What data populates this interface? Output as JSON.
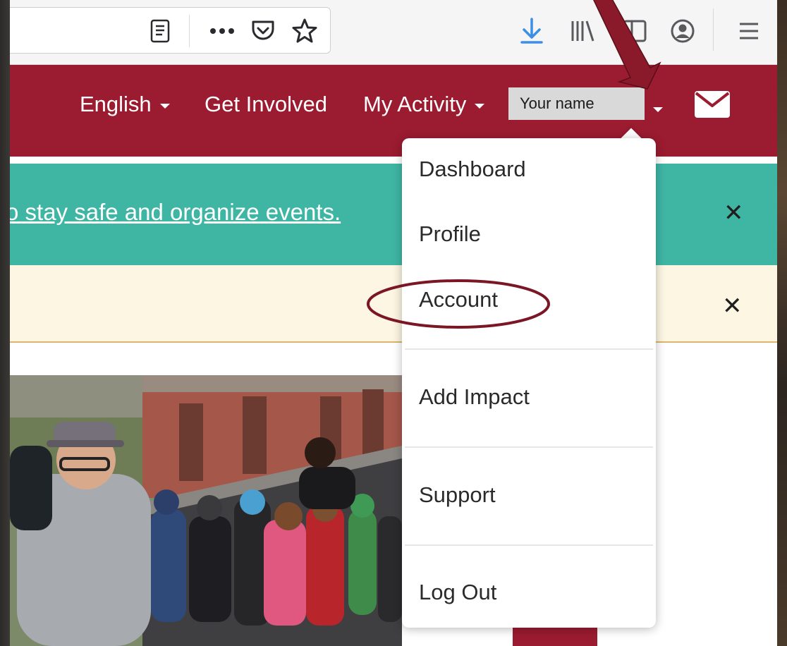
{
  "header": {
    "nav": {
      "language": "English",
      "get_involved": "Get Involved",
      "my_activity": "My Activity"
    },
    "user_name": "Your name"
  },
  "teal_banner": {
    "text": "o stay safe and organize events."
  },
  "user_menu": {
    "items": [
      "Dashboard",
      "Profile",
      "Account",
      "Add Impact",
      "Support",
      "Log Out"
    ]
  },
  "colors": {
    "brand_red": "#9b1b30",
    "banner_teal": "#3fb6a4",
    "banner_cream": "#fcf6e2",
    "annotation_red": "#7b1725"
  }
}
